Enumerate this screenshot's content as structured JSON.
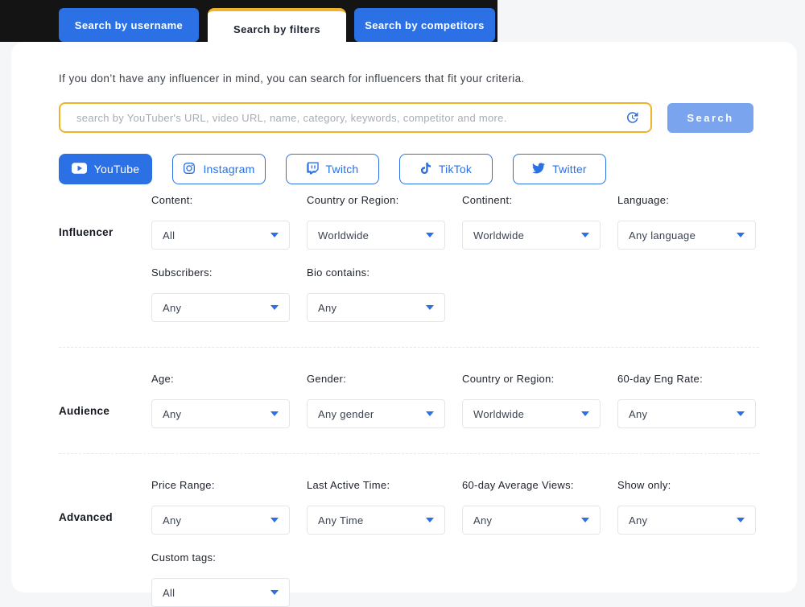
{
  "tabs": [
    {
      "label": "Search by username",
      "active": false
    },
    {
      "label": "Search by filters",
      "active": true
    },
    {
      "label": "Search by competitors",
      "active": false
    }
  ],
  "intro": "If you don’t have any influencer in mind, you can search for influencers that fit your criteria.",
  "search": {
    "placeholder": "search by YouTuber's URL, video URL, name, category, keywords, competitor and more.",
    "button": "Search"
  },
  "platforms": [
    {
      "label": "YouTube",
      "active": true
    },
    {
      "label": "Instagram",
      "active": false
    },
    {
      "label": "Twitch",
      "active": false
    },
    {
      "label": "TikTok",
      "active": false
    },
    {
      "label": "Twitter",
      "active": false
    }
  ],
  "sections": [
    {
      "name": "Influencer",
      "rows": [
        [
          {
            "label": "Content:",
            "value": "All"
          },
          {
            "label": "Country or Region:",
            "value": "Worldwide"
          },
          {
            "label": "Continent:",
            "value": "Worldwide"
          },
          {
            "label": "Language:",
            "value": "Any language"
          }
        ],
        [
          {
            "label": "Subscribers:",
            "value": "Any"
          },
          {
            "label": "Bio contains:",
            "value": "Any"
          }
        ]
      ]
    },
    {
      "name": "Audience",
      "rows": [
        [
          {
            "label": "Age:",
            "value": "Any"
          },
          {
            "label": "Gender:",
            "value": "Any gender"
          },
          {
            "label": "Country or Region:",
            "value": "Worldwide"
          },
          {
            "label": "60-day Eng Rate:",
            "value": "Any"
          }
        ]
      ]
    },
    {
      "name": "Advanced",
      "rows": [
        [
          {
            "label": "Price Range:",
            "value": "Any"
          },
          {
            "label": "Last Active Time:",
            "value": "Any Time"
          },
          {
            "label": "60-day Average Views:",
            "value": "Any"
          },
          {
            "label": "Show only:",
            "value": "Any"
          }
        ],
        [
          {
            "label": "Custom tags:",
            "value": "All"
          }
        ]
      ]
    }
  ],
  "icons": {
    "history": "history-icon",
    "caret": "caret-down-icon",
    "youtube": "youtube-play-icon",
    "instagram": "instagram-icon",
    "twitch": "twitch-icon",
    "tiktok": "tiktok-note-icon",
    "twitter": "twitter-bird-icon"
  },
  "colors": {
    "accent_blue": "#2B70E4",
    "light_blue": "#7AA4EE",
    "gold": "#EFB32B",
    "dark_band": "#141414",
    "page_bg": "#F5F6F7"
  }
}
